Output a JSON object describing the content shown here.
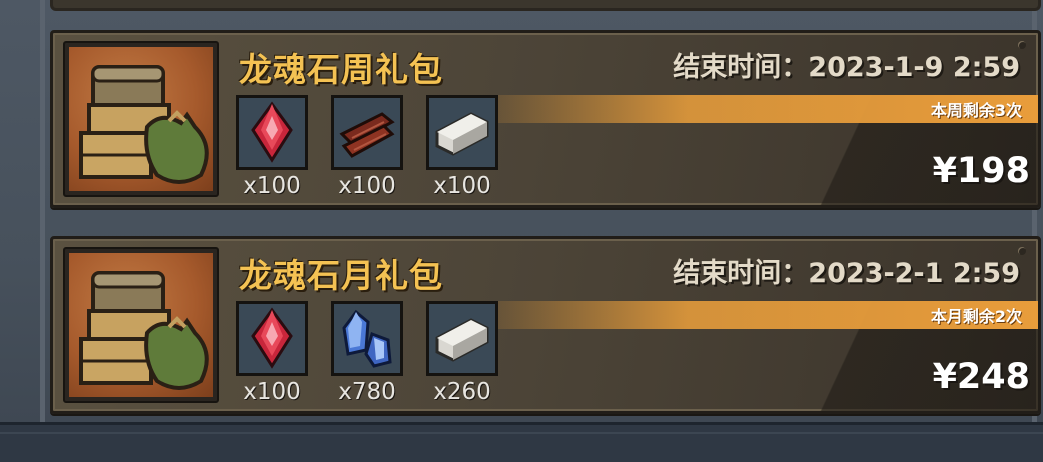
{
  "packs": [
    {
      "title": "龙魂石周礼包",
      "end_label": "结束时间：2023-1-9 2:59",
      "remaining": "本周剩余3次",
      "price": "¥198",
      "items": [
        {
          "icon": "red-crystal-icon",
          "qty": "x100"
        },
        {
          "icon": "wood-planks-icon",
          "qty": "x100"
        },
        {
          "icon": "stone-block-icon",
          "qty": "x100"
        }
      ]
    },
    {
      "title": "龙魂石月礼包",
      "end_label": "结束时间：2023-2-1 2:59",
      "remaining": "本月剩余2次",
      "price": "¥248",
      "items": [
        {
          "icon": "red-crystal-icon",
          "qty": "x100"
        },
        {
          "icon": "blue-crystal-icon",
          "qty": "x780"
        },
        {
          "icon": "stone-block-icon",
          "qty": "x260"
        }
      ]
    }
  ],
  "colors": {
    "title": "#f4c253",
    "remaining_bar": "#e99d3b",
    "card_bg": "#4d4538",
    "page_bg": "#47515c"
  }
}
